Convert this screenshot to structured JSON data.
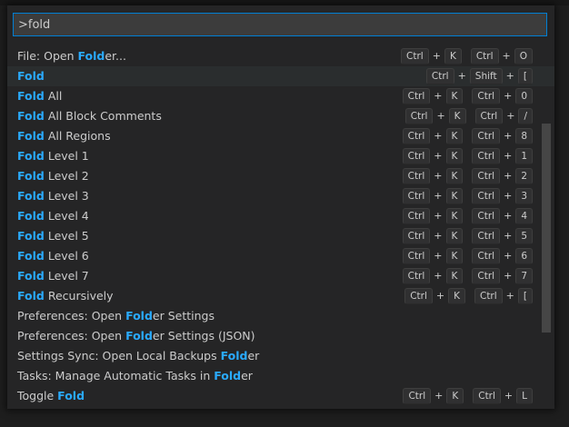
{
  "input": {
    "value": ">fold",
    "placeholder": ""
  },
  "items": [
    {
      "parts": [
        {
          "t": "File: Open ",
          "h": false
        },
        {
          "t": "Fold",
          "h": true
        },
        {
          "t": "er...",
          "h": false
        }
      ],
      "keys": [
        [
          "Ctrl",
          "K"
        ],
        [
          "Ctrl",
          "O"
        ]
      ],
      "selected": false
    },
    {
      "parts": [
        {
          "t": "Fold",
          "h": true
        }
      ],
      "keys": [
        [
          "Ctrl",
          "Shift",
          "["
        ]
      ],
      "selected": true
    },
    {
      "parts": [
        {
          "t": "Fold",
          "h": true
        },
        {
          "t": " All",
          "h": false
        }
      ],
      "keys": [
        [
          "Ctrl",
          "K"
        ],
        [
          "Ctrl",
          "0"
        ]
      ],
      "selected": false
    },
    {
      "parts": [
        {
          "t": "Fold",
          "h": true
        },
        {
          "t": " All Block Comments",
          "h": false
        }
      ],
      "keys": [
        [
          "Ctrl",
          "K"
        ],
        [
          "Ctrl",
          "/"
        ]
      ],
      "selected": false
    },
    {
      "parts": [
        {
          "t": "Fold",
          "h": true
        },
        {
          "t": " All Regions",
          "h": false
        }
      ],
      "keys": [
        [
          "Ctrl",
          "K"
        ],
        [
          "Ctrl",
          "8"
        ]
      ],
      "selected": false
    },
    {
      "parts": [
        {
          "t": "Fold",
          "h": true
        },
        {
          "t": " Level 1",
          "h": false
        }
      ],
      "keys": [
        [
          "Ctrl",
          "K"
        ],
        [
          "Ctrl",
          "1"
        ]
      ],
      "selected": false
    },
    {
      "parts": [
        {
          "t": "Fold",
          "h": true
        },
        {
          "t": " Level 2",
          "h": false
        }
      ],
      "keys": [
        [
          "Ctrl",
          "K"
        ],
        [
          "Ctrl",
          "2"
        ]
      ],
      "selected": false
    },
    {
      "parts": [
        {
          "t": "Fold",
          "h": true
        },
        {
          "t": " Level 3",
          "h": false
        }
      ],
      "keys": [
        [
          "Ctrl",
          "K"
        ],
        [
          "Ctrl",
          "3"
        ]
      ],
      "selected": false
    },
    {
      "parts": [
        {
          "t": "Fold",
          "h": true
        },
        {
          "t": " Level 4",
          "h": false
        }
      ],
      "keys": [
        [
          "Ctrl",
          "K"
        ],
        [
          "Ctrl",
          "4"
        ]
      ],
      "selected": false
    },
    {
      "parts": [
        {
          "t": "Fold",
          "h": true
        },
        {
          "t": " Level 5",
          "h": false
        }
      ],
      "keys": [
        [
          "Ctrl",
          "K"
        ],
        [
          "Ctrl",
          "5"
        ]
      ],
      "selected": false
    },
    {
      "parts": [
        {
          "t": "Fold",
          "h": true
        },
        {
          "t": " Level 6",
          "h": false
        }
      ],
      "keys": [
        [
          "Ctrl",
          "K"
        ],
        [
          "Ctrl",
          "6"
        ]
      ],
      "selected": false
    },
    {
      "parts": [
        {
          "t": "Fold",
          "h": true
        },
        {
          "t": " Level 7",
          "h": false
        }
      ],
      "keys": [
        [
          "Ctrl",
          "K"
        ],
        [
          "Ctrl",
          "7"
        ]
      ],
      "selected": false
    },
    {
      "parts": [
        {
          "t": "Fold",
          "h": true
        },
        {
          "t": " Recursively",
          "h": false
        }
      ],
      "keys": [
        [
          "Ctrl",
          "K"
        ],
        [
          "Ctrl",
          "["
        ]
      ],
      "selected": false
    },
    {
      "parts": [
        {
          "t": "Preferences: Open ",
          "h": false
        },
        {
          "t": "Fold",
          "h": true
        },
        {
          "t": "er Settings",
          "h": false
        }
      ],
      "keys": [],
      "selected": false
    },
    {
      "parts": [
        {
          "t": "Preferences: Open ",
          "h": false
        },
        {
          "t": "Fold",
          "h": true
        },
        {
          "t": "er Settings (JSON)",
          "h": false
        }
      ],
      "keys": [],
      "selected": false
    },
    {
      "parts": [
        {
          "t": "Settings Sync: Open Local Backups ",
          "h": false
        },
        {
          "t": "Fold",
          "h": true
        },
        {
          "t": "er",
          "h": false
        }
      ],
      "keys": [],
      "selected": false
    },
    {
      "parts": [
        {
          "t": "Tasks: Manage Automatic Tasks in ",
          "h": false
        },
        {
          "t": "Fold",
          "h": true
        },
        {
          "t": "er",
          "h": false
        }
      ],
      "keys": [],
      "selected": false
    },
    {
      "parts": [
        {
          "t": "Toggle ",
          "h": false
        },
        {
          "t": "Fold",
          "h": true
        }
      ],
      "keys": [
        [
          "Ctrl",
          "K"
        ],
        [
          "Ctrl",
          "L"
        ]
      ],
      "selected": false
    }
  ],
  "colors": {
    "highlight": "#2aaaff",
    "focus_border": "#007fd4",
    "background": "#252526"
  }
}
